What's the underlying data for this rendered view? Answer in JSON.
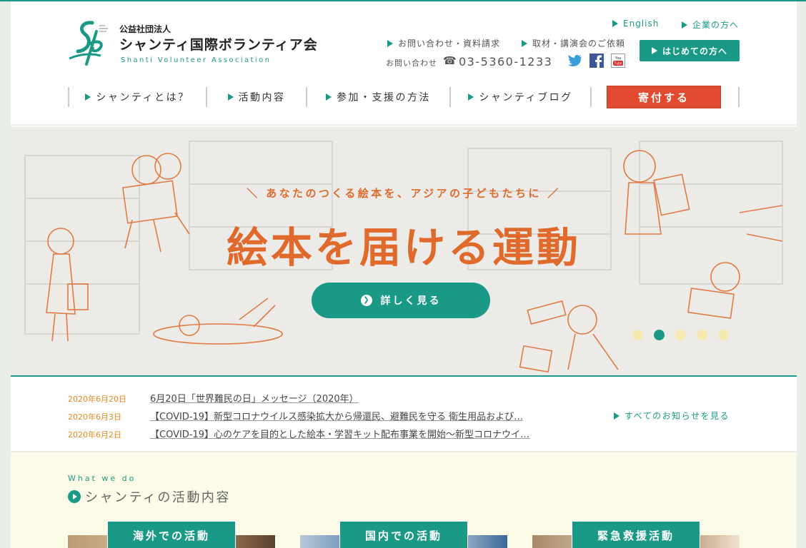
{
  "header": {
    "logo_sub": "公益社団法人",
    "logo_main": "シャンティ国際ボランティア会",
    "logo_en": "Shanti Volunteer Association",
    "links": {
      "english": "English",
      "companies": "企業の方へ",
      "inquiry": "お問い合わせ・資料請求",
      "interview": "取材・講演会のご依頼"
    },
    "phone_label": "お問い合わせ",
    "phone_icon": "☎",
    "phone_number": "03-5360-1233",
    "first_time_label": "はじめての方へ",
    "social": [
      "twitter-icon",
      "facebook-icon",
      "youtube-icon"
    ]
  },
  "nav": {
    "items": [
      {
        "label": "シャンティとは？"
      },
      {
        "label": "活動内容"
      },
      {
        "label": "参加・支援の方法"
      },
      {
        "label": "シャンティブログ"
      }
    ],
    "donate_label": "寄付する"
  },
  "hero": {
    "tagline": "＼ あなたのつくる絵本を、アジアの子どもたちに ／",
    "headline": "絵本を届ける運動",
    "button_label": "詳しく見る",
    "slides": 5,
    "active_slide": 2
  },
  "news": {
    "items": [
      {
        "date": "2020年6月20日",
        "title": "6月20日「世界難民の日」メッセージ（2020年）"
      },
      {
        "date": "2020年6月3日",
        "title": "【COVID-19】新型コロナウイルス感染拡大から帰還民、避難民を守る 衛生用品および…"
      },
      {
        "date": "2020年6月2日",
        "title": "【COVID-19】心のケアを目的とした絵本・学習キット配布事業を開始～新型コロナウイ…"
      }
    ],
    "all_label": "すべてのお知らせを見る"
  },
  "what_we_do": {
    "eyebrow": "What we do",
    "title": "シャンティの活動内容",
    "cards": [
      {
        "label": "海外での活動"
      },
      {
        "label": "国内での活動"
      },
      {
        "label": "緊急救援活動"
      }
    ]
  },
  "colors": {
    "brand_green": "#1a9a86",
    "donate_red": "#e24a2f",
    "hero_orange": "#e06a2c",
    "date_orange": "#e6891a"
  }
}
